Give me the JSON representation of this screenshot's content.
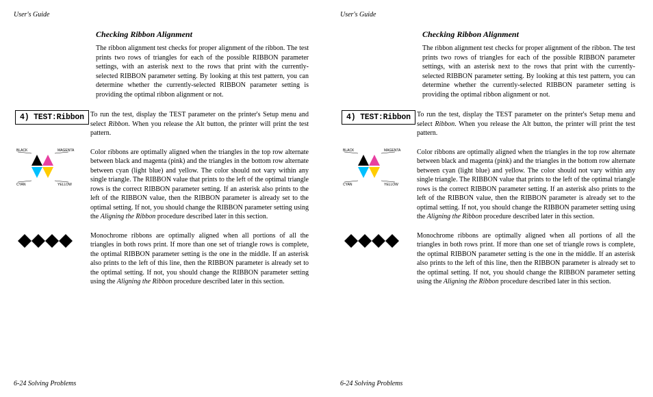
{
  "header": "User's Guide",
  "footer": "6-24  Solving Problems",
  "section_title": "Checking Ribbon Alignment",
  "intro": "The ribbon alignment test checks for proper alignment of the ribbon.  The test prints two rows of triangles for each of the possible RIBBON parameter settings, with an asterisk next to the rows that print with the currently-selected RIBBON parameter setting.  By looking at this test pattern, you can determine whether the currently-selected RIBBON parameter setting is providing the optimal ribbon alignment or not.",
  "testbox_label": "4) TEST:Ribbon",
  "test_instruction_1": "To run the test, display the TEST parameter on the printer's Setup menu and select ",
  "test_instruction_em": "Ribbon",
  "test_instruction_2": ".  When you release the Alt button, the printer will print the test pattern.",
  "color_para_1": "Color ribbons are optimally aligned when the triangles in the top row alternate between black and magenta (pink) and the triangles in the bottom row alternate between cyan (light blue) and yellow.  The color should not vary within any single triangle.  The RIBBON value that prints to the left of the optimal triangle rows is the correct RIBBON parameter setting.  If an asterisk also prints to the left of the RIBBON value, then the RIBBON parameter is already set to the optimal setting.  If not, you should change the RIBBON parameter setting using the ",
  "color_para_em": "Aligning the Ribbon",
  "color_para_2": " procedure described later in this section.",
  "mono_para_1": "Monochrome ribbons are optimally aligned when all portions of all the triangles in both rows print.  If more than one set of triangle rows is complete, the optimal RIBBON parameter setting is the one in the middle.  If an asterisk also prints to the left of this line, then the RIBBON parameter is already set to the optimal setting.  If not, you should change the RIBBON parameter setting using the ",
  "mono_para_em": "Aligning the Ribbon",
  "mono_para_2": " procedure described later in this section.",
  "labels": {
    "black": "BLACK",
    "magenta": "MAGENTA",
    "cyan": "CYAN",
    "yellow": "YELLOW"
  }
}
